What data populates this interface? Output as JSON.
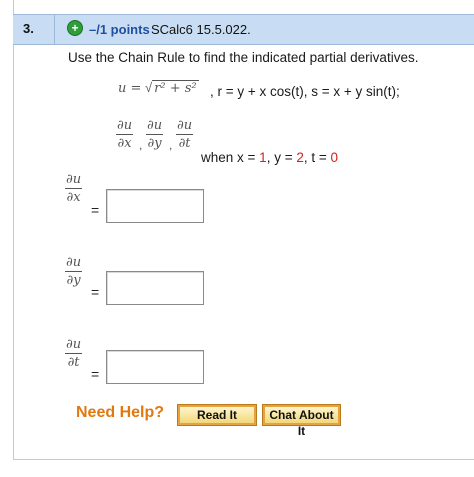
{
  "question": {
    "number": "3.",
    "points": "–/1 points",
    "reference": "SCalc6 15.5.022.",
    "instruction": "Use the Chain Rule to find the indicated partial derivatives.",
    "u_equals": "u =",
    "radicand": "r² + s²",
    "relations": ", r = y + x cos(t), s = x + y sin(t);",
    "partials": {
      "du": "∂u",
      "dx": "∂x",
      "dy": "∂y",
      "dt": "∂t",
      "sep": ","
    },
    "when_label": "when ",
    "x_label": "x = ",
    "x_value": "1",
    "y_label": ", y = ",
    "y_value": "2",
    "t_label": ", t = ",
    "t_value": "0"
  },
  "answers": [
    {
      "num": "∂u",
      "den": "∂x",
      "eq": "=",
      "value": ""
    },
    {
      "num": "∂u",
      "den": "∂y",
      "eq": "=",
      "value": ""
    },
    {
      "num": "∂u",
      "den": "∂t",
      "eq": "=",
      "value": ""
    }
  ],
  "help": {
    "label": "Need Help?",
    "read_button": "Read It",
    "chat_button": "Chat About It"
  },
  "colors": {
    "header_bg": "#c8ddf3",
    "points_text": "#1f4f9f",
    "highlight_red": "#d42020",
    "help_orange": "#e07a10"
  },
  "icons": {
    "add": "plus-icon"
  }
}
